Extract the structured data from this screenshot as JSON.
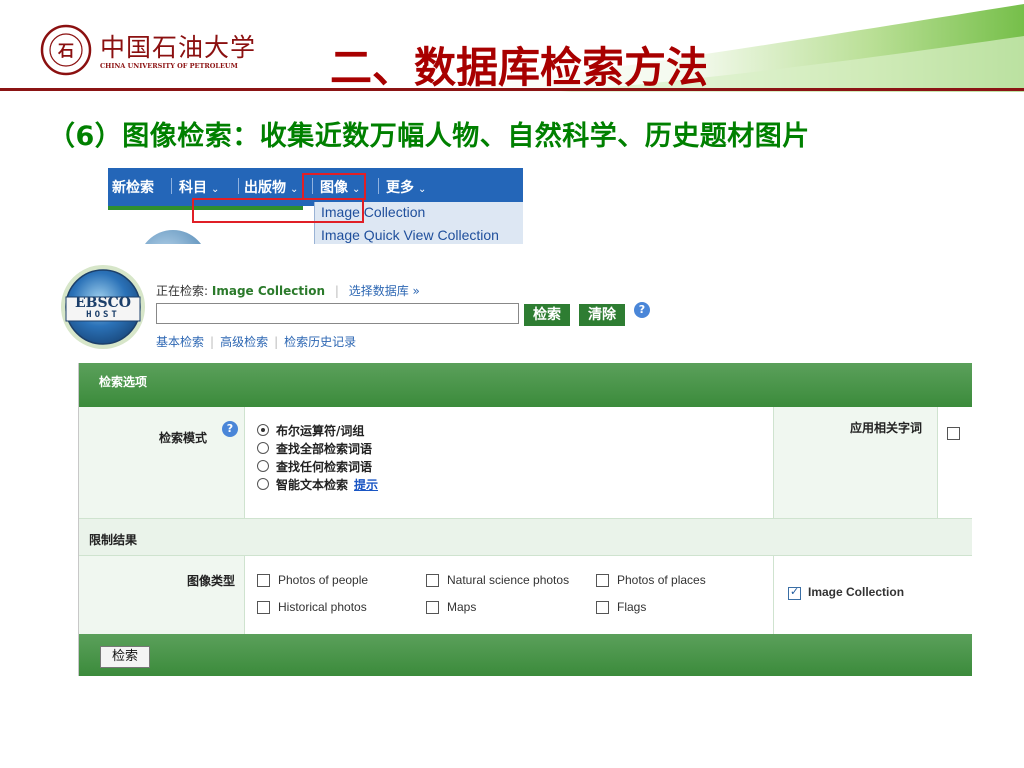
{
  "header": {
    "university_cn": "中国石油大学",
    "university_en": "CHINA UNIVERSITY OF PETROLEUM",
    "slide_title": "二、数据库检索方法",
    "subtitle": "（6）图像检索：收集近数万幅人物、自然科学、历史题材图片"
  },
  "menu": {
    "items": [
      "新检索",
      "科目",
      "出版物",
      "图像",
      "更多"
    ],
    "dropdown": [
      "Image Collection",
      "Image Quick View Collection"
    ]
  },
  "ebsco": {
    "logo_line1": "EBSCO",
    "logo_line2": "HOST",
    "searching_label": "正在检索:",
    "searching_db": "Image Collection",
    "choose_db": "选择数据库 »",
    "search_value": "",
    "search_button": "检索",
    "clear_button": "清除",
    "links": [
      "基本检索",
      "高级检索",
      "检索历史记录"
    ]
  },
  "options": {
    "header": "检索选项",
    "mode_label": "检索模式",
    "modes": [
      "布尔运算符/词组",
      "查找全部检索词语",
      "查找任何检索词语",
      "智能文本检索"
    ],
    "selected_mode": "布尔运算符/词组",
    "hint_link": "提示",
    "related_words_label": "应用相关字词",
    "limit_header": "限制结果",
    "image_type_label": "图像类型",
    "image_types": [
      "Photos of people",
      "Natural science photos",
      "Photos of places",
      "Historical photos",
      "Maps",
      "Flags"
    ],
    "collection_option": "Image Collection",
    "collection_checked": true,
    "footer_button": "检索"
  },
  "colors": {
    "title_red": "#a80000",
    "subtitle_green": "#008000",
    "menu_blue": "#2466b8",
    "ebsco_green": "#2e7d32",
    "highlight_red": "#e01f26"
  }
}
